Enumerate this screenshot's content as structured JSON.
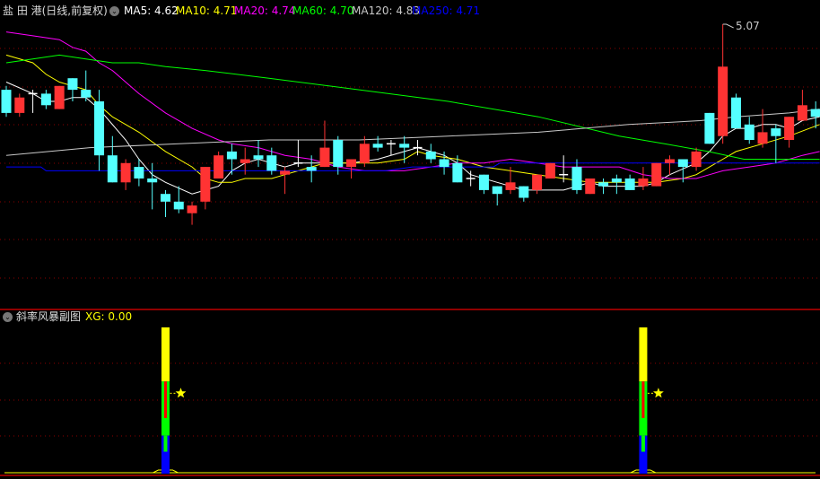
{
  "header": {
    "title": "盐 田 港(日线,前复权)",
    "ma_labels": [
      {
        "text": "MA5: 4.62",
        "color": "#ffffff"
      },
      {
        "text": "MA10: 4.71",
        "color": "#ffff00"
      },
      {
        "text": "MA20: 4.74",
        "color": "#ff00ff"
      },
      {
        "text": "MA60: 4.70",
        "color": "#00ff00"
      },
      {
        "text": "MA120: 4.83",
        "color": "#c8c8c8"
      },
      {
        "text": "MA250: 4.71",
        "color": "#0000ff"
      }
    ]
  },
  "sub_header": {
    "title": "斜率风暴副图",
    "xg_label": "XG: 0.00"
  },
  "colors": {
    "up": "#ff3333",
    "down": "#54ffff",
    "doji": "#ffffff",
    "grid": "#8b0000",
    "border": "#c00000"
  },
  "chart_data": [
    {
      "type": "candlestick",
      "title": "盐田港 日线 前复权",
      "ylim": [
        4.55,
        5.07
      ],
      "high_annotation": "5.07",
      "candles": [
        [
          4.9,
          4.91,
          4.83,
          4.84
        ],
        [
          4.84,
          4.89,
          4.83,
          4.88
        ],
        [
          4.89,
          4.9,
          4.84,
          4.89
        ],
        [
          4.89,
          4.9,
          4.85,
          4.86
        ],
        [
          4.85,
          4.91,
          4.85,
          4.91
        ],
        [
          4.93,
          4.93,
          4.87,
          4.9
        ],
        [
          4.9,
          4.95,
          4.87,
          4.88
        ],
        [
          4.87,
          4.9,
          4.69,
          4.73
        ],
        [
          4.73,
          4.78,
          4.66,
          4.66
        ],
        [
          4.66,
          4.72,
          4.64,
          4.71
        ],
        [
          4.7,
          4.72,
          4.65,
          4.67
        ],
        [
          4.67,
          4.71,
          4.59,
          4.66
        ],
        [
          4.63,
          4.64,
          4.57,
          4.61
        ],
        [
          4.61,
          4.65,
          4.58,
          4.59
        ],
        [
          4.58,
          4.61,
          4.55,
          4.6
        ],
        [
          4.61,
          4.7,
          4.59,
          4.7
        ],
        [
          4.67,
          4.74,
          4.67,
          4.73
        ],
        [
          4.74,
          4.76,
          4.68,
          4.72
        ],
        [
          4.71,
          4.75,
          4.68,
          4.72
        ],
        [
          4.73,
          4.77,
          4.7,
          4.72
        ],
        [
          4.73,
          4.75,
          4.68,
          4.69
        ],
        [
          4.68,
          4.7,
          4.63,
          4.69
        ],
        [
          4.71,
          4.77,
          4.7,
          4.71
        ],
        [
          4.7,
          4.73,
          4.66,
          4.69
        ],
        [
          4.7,
          4.82,
          4.7,
          4.75
        ],
        [
          4.77,
          4.78,
          4.68,
          4.7
        ],
        [
          4.7,
          4.72,
          4.67,
          4.72
        ],
        [
          4.71,
          4.78,
          4.7,
          4.76
        ],
        [
          4.76,
          4.78,
          4.74,
          4.75
        ],
        [
          4.76,
          4.77,
          4.73,
          4.76
        ],
        [
          4.76,
          4.78,
          4.71,
          4.75
        ],
        [
          4.75,
          4.77,
          4.73,
          4.75
        ],
        [
          4.74,
          4.76,
          4.71,
          4.72
        ],
        [
          4.72,
          4.74,
          4.68,
          4.7
        ],
        [
          4.71,
          4.73,
          4.66,
          4.66
        ],
        [
          4.67,
          4.69,
          4.65,
          4.67
        ],
        [
          4.68,
          4.68,
          4.63,
          4.64
        ],
        [
          4.65,
          4.65,
          4.6,
          4.63
        ],
        [
          4.64,
          4.7,
          4.63,
          4.66
        ],
        [
          4.65,
          4.65,
          4.61,
          4.62
        ],
        [
          4.64,
          4.68,
          4.63,
          4.68
        ],
        [
          4.67,
          4.71,
          4.67,
          4.71
        ],
        [
          4.68,
          4.73,
          4.66,
          4.68
        ],
        [
          4.7,
          4.72,
          4.63,
          4.64
        ],
        [
          4.63,
          4.67,
          4.63,
          4.67
        ],
        [
          4.66,
          4.67,
          4.63,
          4.65
        ],
        [
          4.67,
          4.68,
          4.63,
          4.66
        ],
        [
          4.67,
          4.68,
          4.64,
          4.64
        ],
        [
          4.65,
          4.7,
          4.64,
          4.67
        ],
        [
          4.65,
          4.71,
          4.65,
          4.71
        ],
        [
          4.71,
          4.73,
          4.68,
          4.72
        ],
        [
          4.72,
          4.72,
          4.66,
          4.7
        ],
        [
          4.7,
          4.75,
          4.69,
          4.74
        ],
        [
          4.84,
          4.84,
          4.76,
          4.76
        ],
        [
          4.78,
          5.07,
          4.76,
          4.96
        ],
        [
          4.88,
          4.89,
          4.8,
          4.8
        ],
        [
          4.81,
          4.83,
          4.76,
          4.77
        ],
        [
          4.76,
          4.85,
          4.75,
          4.79
        ],
        [
          4.8,
          4.81,
          4.71,
          4.78
        ],
        [
          4.77,
          4.83,
          4.75,
          4.83
        ],
        [
          4.82,
          4.9,
          4.82,
          4.86
        ],
        [
          4.85,
          4.87,
          4.8,
          4.83
        ]
      ],
      "candle_format": [
        "open",
        "high",
        "low",
        "close"
      ],
      "series": [
        {
          "name": "MA5",
          "color": "#ffffff",
          "points": [
            [
              0,
              4.92
            ],
            [
              2,
              4.89
            ],
            [
              3,
              4.87
            ],
            [
              4,
              4.87
            ],
            [
              5,
              4.88
            ],
            [
              6,
              4.88
            ],
            [
              7,
              4.85
            ],
            [
              9,
              4.77
            ],
            [
              10,
              4.72
            ],
            [
              11,
              4.68
            ],
            [
              12,
              4.66
            ],
            [
              14,
              4.63
            ],
            [
              15,
              4.64
            ],
            [
              16,
              4.65
            ],
            [
              17,
              4.69
            ],
            [
              18,
              4.71
            ],
            [
              19,
              4.72
            ],
            [
              20,
              4.71
            ],
            [
              21,
              4.7
            ],
            [
              22,
              4.71
            ],
            [
              23,
              4.71
            ],
            [
              24,
              4.71
            ],
            [
              25,
              4.71
            ],
            [
              26,
              4.71
            ],
            [
              28,
              4.72
            ],
            [
              30,
              4.74
            ],
            [
              31,
              4.75
            ],
            [
              32,
              4.74
            ],
            [
              33,
              4.73
            ],
            [
              34,
              4.71
            ],
            [
              35,
              4.68
            ],
            [
              37,
              4.66
            ],
            [
              39,
              4.64
            ],
            [
              41,
              4.64
            ],
            [
              42,
              4.64
            ],
            [
              43,
              4.65
            ],
            [
              44,
              4.66
            ],
            [
              45,
              4.65
            ],
            [
              47,
              4.65
            ],
            [
              48,
              4.65
            ],
            [
              49,
              4.66
            ],
            [
              50,
              4.68
            ],
            [
              52,
              4.71
            ],
            [
              53,
              4.74
            ],
            [
              54,
              4.78
            ],
            [
              55,
              4.8
            ],
            [
              56,
              4.8
            ],
            [
              57,
              4.81
            ],
            [
              58,
              4.81
            ],
            [
              59,
              4.8
            ],
            [
              60,
              4.82
            ],
            [
              61.3,
              4.83
            ]
          ]
        },
        {
          "name": "MA10",
          "color": "#ffff00",
          "points": [
            [
              0,
              4.99
            ],
            [
              2,
              4.97
            ],
            [
              3,
              4.94
            ],
            [
              4,
              4.92
            ],
            [
              5,
              4.91
            ],
            [
              6,
              4.9
            ],
            [
              7,
              4.86
            ],
            [
              8,
              4.83
            ],
            [
              10,
              4.79
            ],
            [
              12,
              4.74
            ],
            [
              14,
              4.7
            ],
            [
              15,
              4.67
            ],
            [
              16,
              4.66
            ],
            [
              17,
              4.66
            ],
            [
              18,
              4.67
            ],
            [
              20,
              4.67
            ],
            [
              21,
              4.68
            ],
            [
              22,
              4.69
            ],
            [
              23,
              4.7
            ],
            [
              24,
              4.71
            ],
            [
              26,
              4.71
            ],
            [
              28,
              4.71
            ],
            [
              30,
              4.72
            ],
            [
              31,
              4.74
            ],
            [
              32,
              4.73
            ],
            [
              34,
              4.72
            ],
            [
              36,
              4.7
            ],
            [
              38,
              4.69
            ],
            [
              40,
              4.68
            ],
            [
              42,
              4.67
            ],
            [
              44,
              4.66
            ],
            [
              46,
              4.66
            ],
            [
              47,
              4.66
            ],
            [
              49,
              4.66
            ],
            [
              51,
              4.67
            ],
            [
              52,
              4.68
            ],
            [
              53,
              4.7
            ],
            [
              54,
              4.72
            ],
            [
              55,
              4.74
            ],
            [
              57,
              4.76
            ],
            [
              59,
              4.78
            ],
            [
              61.3,
              4.81
            ]
          ]
        },
        {
          "name": "MA20",
          "color": "#ff00ff",
          "points": [
            [
              0,
              5.05
            ],
            [
              2,
              5.04
            ],
            [
              4,
              5.03
            ],
            [
              5,
              5.01
            ],
            [
              6,
              5.0
            ],
            [
              7,
              4.97
            ],
            [
              8,
              4.95
            ],
            [
              9,
              4.92
            ],
            [
              10,
              4.89
            ],
            [
              12,
              4.84
            ],
            [
              14,
              4.8
            ],
            [
              16,
              4.77
            ],
            [
              17,
              4.76
            ],
            [
              19,
              4.75
            ],
            [
              21,
              4.73
            ],
            [
              23,
              4.72
            ],
            [
              25,
              4.7
            ],
            [
              27,
              4.69
            ],
            [
              28,
              4.69
            ],
            [
              30,
              4.69
            ],
            [
              32,
              4.7
            ],
            [
              34,
              4.71
            ],
            [
              36,
              4.71
            ],
            [
              38,
              4.72
            ],
            [
              40,
              4.71
            ],
            [
              42,
              4.7
            ],
            [
              44,
              4.7
            ],
            [
              46.2,
              4.7
            ],
            [
              48,
              4.68
            ],
            [
              50,
              4.67
            ],
            [
              52,
              4.67
            ],
            [
              53,
              4.68
            ],
            [
              54,
              4.69
            ],
            [
              56,
              4.7
            ],
            [
              58,
              4.71
            ],
            [
              60,
              4.73
            ],
            [
              61.3,
              4.74
            ]
          ]
        },
        {
          "name": "MA60",
          "color": "#00ff00",
          "points": [
            [
              0,
              4.97
            ],
            [
              2,
              4.98
            ],
            [
              4,
              4.99
            ],
            [
              6,
              4.98
            ],
            [
              8,
              4.97
            ],
            [
              10,
              4.97
            ],
            [
              12,
              4.96
            ],
            [
              15,
              4.95
            ],
            [
              19.8,
              4.93
            ],
            [
              26.6,
              4.9
            ],
            [
              33.3,
              4.87
            ],
            [
              40.1,
              4.83
            ],
            [
              46.2,
              4.78
            ],
            [
              49.6,
              4.76
            ],
            [
              52.9,
              4.74
            ],
            [
              55.6,
              4.72
            ],
            [
              58.4,
              4.72
            ],
            [
              61.3,
              4.72
            ]
          ]
        },
        {
          "name": "MA120",
          "color": "#c8c8c8",
          "points": [
            [
              0,
              4.73
            ],
            [
              6.3,
              4.75
            ],
            [
              13,
              4.76
            ],
            [
              19.8,
              4.77
            ],
            [
              26.6,
              4.77
            ],
            [
              33.3,
              4.78
            ],
            [
              40.1,
              4.79
            ],
            [
              46.9,
              4.81
            ],
            [
              52.3,
              4.82
            ],
            [
              55,
              4.83
            ],
            [
              59,
              4.84
            ],
            [
              61.3,
              4.85
            ]
          ]
        },
        {
          "name": "MA250",
          "color": "#0000ff",
          "points": [
            [
              0,
              4.7
            ],
            [
              2.6,
              4.7
            ],
            [
              3,
              4.69
            ],
            [
              28.6,
              4.69
            ],
            [
              30.6,
              4.7
            ],
            [
              36.7,
              4.7
            ],
            [
              37.2,
              4.71
            ],
            [
              61.3,
              4.71
            ]
          ]
        }
      ]
    },
    {
      "type": "bar",
      "title": "斜率风暴副图",
      "ylim": [
        0,
        100
      ],
      "signals": [
        {
          "index": 12,
          "yellow": [
            63,
            100
          ],
          "green": [
            26,
            63
          ],
          "red": [
            38,
            63
          ],
          "inner_green": [
            15,
            26
          ],
          "blue": [
            0,
            26
          ],
          "star": 55
        },
        {
          "index": 48,
          "yellow": [
            63,
            100
          ],
          "green": [
            26,
            63
          ],
          "red": [
            38,
            63
          ],
          "inner_green": [
            15,
            26
          ],
          "blue": [
            0,
            26
          ],
          "star": 55
        }
      ],
      "xg": 0.0
    }
  ]
}
